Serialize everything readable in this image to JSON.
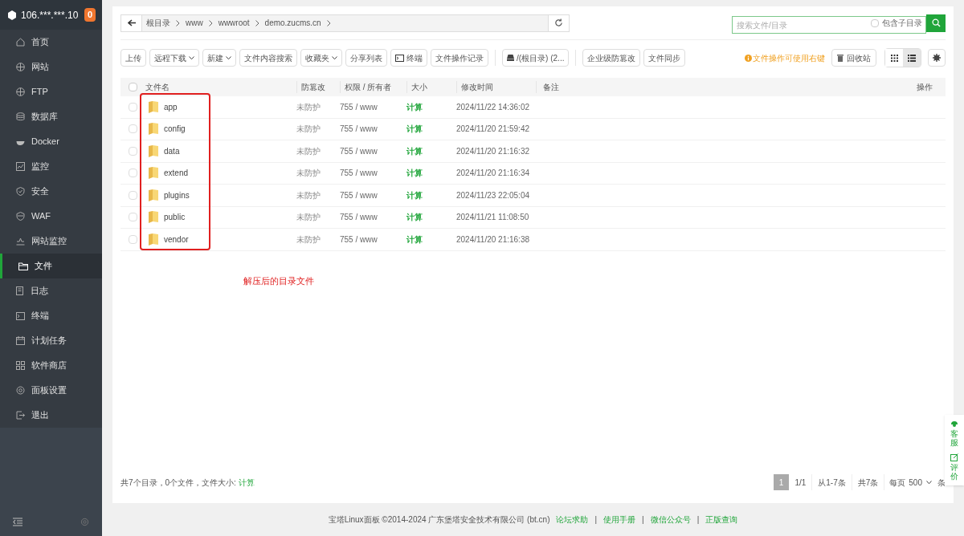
{
  "sidebar": {
    "server": "106.***.***.10",
    "badge": "0",
    "items": [
      {
        "label": "首页",
        "selected": false
      },
      {
        "label": "网站",
        "selected": false
      },
      {
        "label": "FTP",
        "selected": false
      },
      {
        "label": "数据库",
        "selected": false
      },
      {
        "label": "Docker",
        "selected": false
      },
      {
        "label": "监控",
        "selected": false
      },
      {
        "label": "安全",
        "selected": false
      },
      {
        "label": "WAF",
        "selected": false
      },
      {
        "label": "网站监控",
        "selected": false
      },
      {
        "label": "文件",
        "selected": true
      },
      {
        "label": "日志",
        "selected": false
      },
      {
        "label": "终端",
        "selected": false
      },
      {
        "label": "计划任务",
        "selected": false
      },
      {
        "label": "软件商店",
        "selected": false
      },
      {
        "label": "面板设置",
        "selected": false
      },
      {
        "label": "退出",
        "selected": false
      }
    ]
  },
  "breadcrumb": [
    "根目录",
    "www",
    "wwwroot",
    "demo.zucms.cn"
  ],
  "search": {
    "placeholder": "搜索文件/目录",
    "include_subdirs": {
      "label": "包含子目录",
      "checked": false
    }
  },
  "toolbar": {
    "groups": [
      [
        {
          "label": "上传",
          "kind": "plain",
          "dropdown": false
        },
        {
          "label": "远程下载",
          "kind": "plain",
          "dropdown": true
        },
        {
          "label": "新建",
          "kind": "plain",
          "dropdown": true
        },
        {
          "label": "文件内容搜索",
          "kind": "plain",
          "dropdown": false
        },
        {
          "label": "收藏夹",
          "kind": "plain",
          "dropdown": true
        },
        {
          "label": "分享列表",
          "kind": "plain",
          "dropdown": false
        },
        {
          "label": "终端",
          "kind": "terminal",
          "dropdown": false
        },
        {
          "label": "文件操作记录",
          "kind": "plain",
          "dropdown": false
        }
      ],
      [
        {
          "label": "/(根目录) (2...",
          "kind": "disk",
          "dropdown": false
        }
      ],
      [
        {
          "label": "企业级防篡改",
          "kind": "plain",
          "dropdown": false
        },
        {
          "label": "文件同步",
          "kind": "plain",
          "dropdown": false
        }
      ]
    ],
    "tip": "文件操作可使用右键",
    "recycle": "回收站",
    "views": [
      {
        "kind": "grid",
        "selected": false
      },
      {
        "kind": "list",
        "selected": true
      }
    ]
  },
  "table": {
    "columns": [
      "文件名",
      "防篡改",
      "权限 / 所有者",
      "大小",
      "修改时间",
      "备注",
      "操作"
    ],
    "all_checked": false,
    "rows": [
      {
        "name": "app",
        "tamper": "未防护",
        "perm": "755 / www",
        "size": "计算",
        "mtime": "2024/11/22 14:36:02",
        "checked": false
      },
      {
        "name": "config",
        "tamper": "未防护",
        "perm": "755 / www",
        "size": "计算",
        "mtime": "2024/11/20 21:59:42",
        "checked": false
      },
      {
        "name": "data",
        "tamper": "未防护",
        "perm": "755 / www",
        "size": "计算",
        "mtime": "2024/11/20 21:16:32",
        "checked": false
      },
      {
        "name": "extend",
        "tamper": "未防护",
        "perm": "755 / www",
        "size": "计算",
        "mtime": "2024/11/20 21:16:34",
        "checked": false
      },
      {
        "name": "plugins",
        "tamper": "未防护",
        "perm": "755 / www",
        "size": "计算",
        "mtime": "2024/11/23 22:05:04",
        "checked": false
      },
      {
        "name": "public",
        "tamper": "未防护",
        "perm": "755 / www",
        "size": "计算",
        "mtime": "2024/11/21 11:08:50",
        "checked": false
      },
      {
        "name": "vendor",
        "tamper": "未防护",
        "perm": "755 / www",
        "size": "计算",
        "mtime": "2024/11/20 21:16:38",
        "checked": false
      }
    ]
  },
  "annotation": "解压后的目录文件",
  "summary": {
    "text": "共7个目录，0个文件，文件大小:",
    "link": "计算"
  },
  "pagination": {
    "current": "1",
    "pages": "1/1",
    "range": "从1-7条",
    "total": "共7条",
    "per_page_label": "每页",
    "per_page": "500",
    "unit": "条"
  },
  "float_buttons": [
    "客服",
    "评价"
  ],
  "footer": {
    "text": "宝塔Linux面板 ©2014-2024 广东堡塔安全技术有限公司 (bt.cn)",
    "items": [
      {
        "kind": "link",
        "text": "论坛求助"
      },
      {
        "kind": "separator",
        "text": "|"
      },
      {
        "kind": "link",
        "text": "使用手册"
      },
      {
        "kind": "separator",
        "text": "|"
      },
      {
        "kind": "link",
        "text": "微信公众号"
      },
      {
        "kind": "separator",
        "text": "|"
      },
      {
        "kind": "link",
        "text": "正版查询"
      }
    ]
  }
}
